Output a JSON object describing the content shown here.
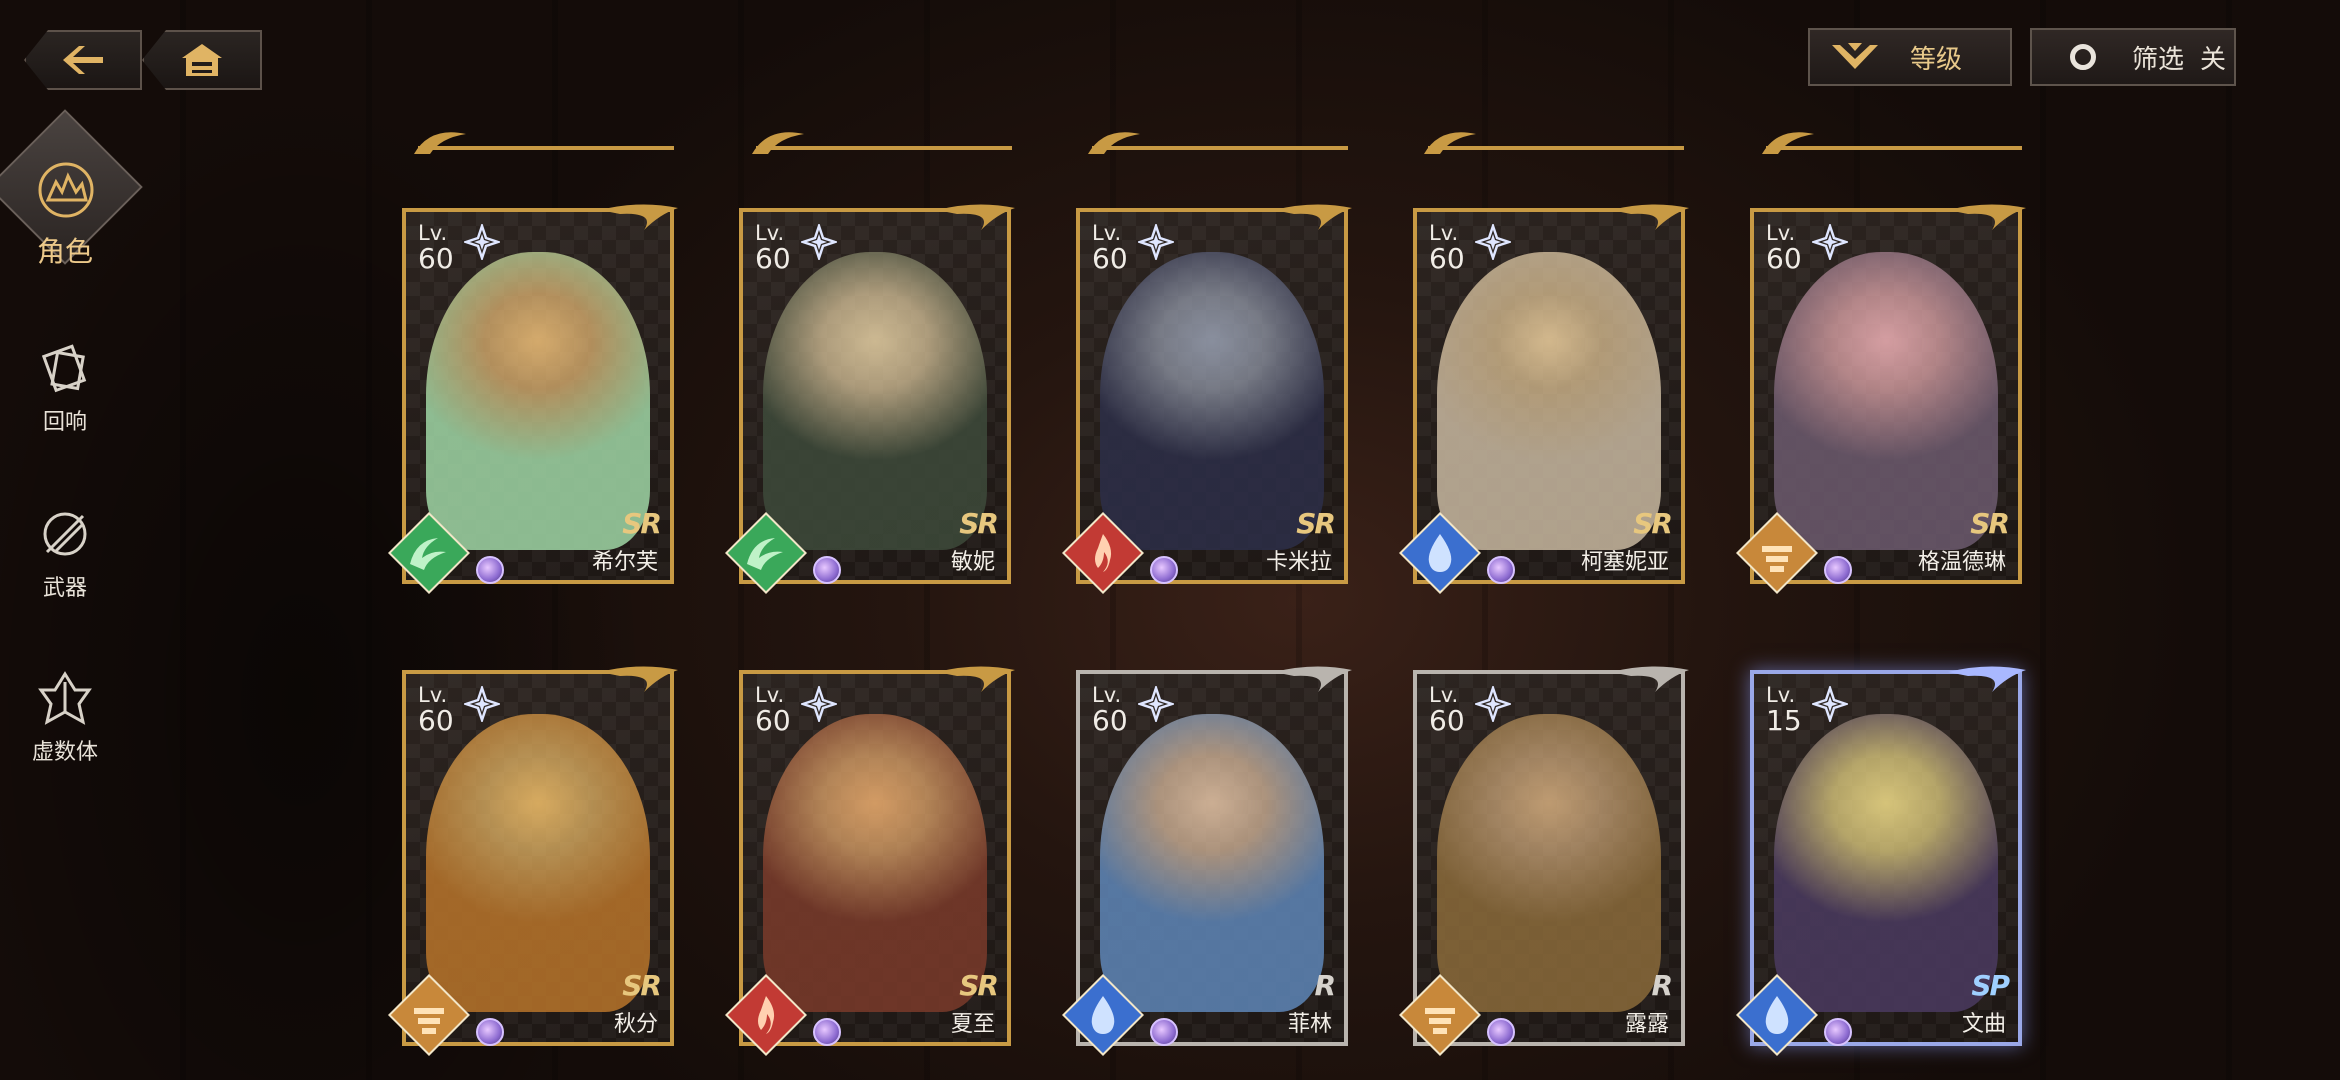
{
  "nav": {
    "back_icon": "arrow-left-icon",
    "home_icon": "home-icon"
  },
  "top_bar": {
    "level_label": "等级",
    "filter_label": "筛选",
    "filter_state": "关"
  },
  "side_menu": [
    {
      "label": "角色",
      "icon": "character-emblem-icon",
      "active": true
    },
    {
      "label": "回响",
      "icon": "echo-icon",
      "active": false
    },
    {
      "label": "武器",
      "icon": "weapon-icon",
      "active": false
    },
    {
      "label": "虚数体",
      "icon": "imaginary-body-icon",
      "active": false
    }
  ],
  "colors": {
    "gold": "#c89a44",
    "silver": "#b9b4ae",
    "ssr_glow": "#9aa8e8",
    "wind": "#3aa85a",
    "fire": "#c23a34",
    "water": "#3b6fcf",
    "earth": "#c8883a"
  },
  "lv_prefix": "Lv.",
  "cards": [
    {
      "name": "希尔芙",
      "level": "60",
      "rarity": "SR",
      "element": "wind"
    },
    {
      "name": "敏妮",
      "level": "60",
      "rarity": "SR",
      "element": "wind"
    },
    {
      "name": "卡米拉",
      "level": "60",
      "rarity": "SR",
      "element": "fire"
    },
    {
      "name": "柯塞妮亚",
      "level": "60",
      "rarity": "SR",
      "element": "water"
    },
    {
      "name": "格温德琳",
      "level": "60",
      "rarity": "SR",
      "element": "earth"
    },
    {
      "name": "秋分",
      "level": "60",
      "rarity": "SR",
      "element": "earth"
    },
    {
      "name": "夏至",
      "level": "60",
      "rarity": "SR",
      "element": "fire"
    },
    {
      "name": "菲林",
      "level": "60",
      "rarity": "R",
      "element": "water"
    },
    {
      "name": "露露",
      "level": "60",
      "rarity": "R",
      "element": "earth"
    },
    {
      "name": "文曲",
      "level": "15",
      "rarity": "SP",
      "element": "water"
    }
  ]
}
